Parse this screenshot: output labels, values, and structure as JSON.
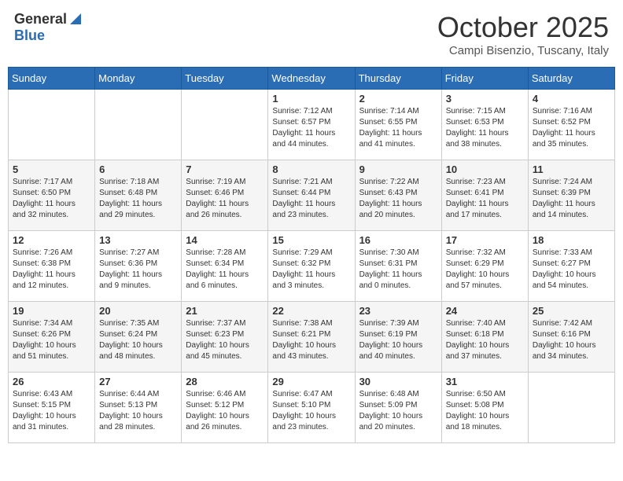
{
  "header": {
    "logo_general": "General",
    "logo_blue": "Blue",
    "month_title": "October 2025",
    "subtitle": "Campi Bisenzio, Tuscany, Italy"
  },
  "days_of_week": [
    "Sunday",
    "Monday",
    "Tuesday",
    "Wednesday",
    "Thursday",
    "Friday",
    "Saturday"
  ],
  "weeks": [
    [
      {
        "day": "",
        "info": ""
      },
      {
        "day": "",
        "info": ""
      },
      {
        "day": "",
        "info": ""
      },
      {
        "day": "1",
        "info": "Sunrise: 7:12 AM\nSunset: 6:57 PM\nDaylight: 11 hours and 44 minutes."
      },
      {
        "day": "2",
        "info": "Sunrise: 7:14 AM\nSunset: 6:55 PM\nDaylight: 11 hours and 41 minutes."
      },
      {
        "day": "3",
        "info": "Sunrise: 7:15 AM\nSunset: 6:53 PM\nDaylight: 11 hours and 38 minutes."
      },
      {
        "day": "4",
        "info": "Sunrise: 7:16 AM\nSunset: 6:52 PM\nDaylight: 11 hours and 35 minutes."
      }
    ],
    [
      {
        "day": "5",
        "info": "Sunrise: 7:17 AM\nSunset: 6:50 PM\nDaylight: 11 hours and 32 minutes."
      },
      {
        "day": "6",
        "info": "Sunrise: 7:18 AM\nSunset: 6:48 PM\nDaylight: 11 hours and 29 minutes."
      },
      {
        "day": "7",
        "info": "Sunrise: 7:19 AM\nSunset: 6:46 PM\nDaylight: 11 hours and 26 minutes."
      },
      {
        "day": "8",
        "info": "Sunrise: 7:21 AM\nSunset: 6:44 PM\nDaylight: 11 hours and 23 minutes."
      },
      {
        "day": "9",
        "info": "Sunrise: 7:22 AM\nSunset: 6:43 PM\nDaylight: 11 hours and 20 minutes."
      },
      {
        "day": "10",
        "info": "Sunrise: 7:23 AM\nSunset: 6:41 PM\nDaylight: 11 hours and 17 minutes."
      },
      {
        "day": "11",
        "info": "Sunrise: 7:24 AM\nSunset: 6:39 PM\nDaylight: 11 hours and 14 minutes."
      }
    ],
    [
      {
        "day": "12",
        "info": "Sunrise: 7:26 AM\nSunset: 6:38 PM\nDaylight: 11 hours and 12 minutes."
      },
      {
        "day": "13",
        "info": "Sunrise: 7:27 AM\nSunset: 6:36 PM\nDaylight: 11 hours and 9 minutes."
      },
      {
        "day": "14",
        "info": "Sunrise: 7:28 AM\nSunset: 6:34 PM\nDaylight: 11 hours and 6 minutes."
      },
      {
        "day": "15",
        "info": "Sunrise: 7:29 AM\nSunset: 6:32 PM\nDaylight: 11 hours and 3 minutes."
      },
      {
        "day": "16",
        "info": "Sunrise: 7:30 AM\nSunset: 6:31 PM\nDaylight: 11 hours and 0 minutes."
      },
      {
        "day": "17",
        "info": "Sunrise: 7:32 AM\nSunset: 6:29 PM\nDaylight: 10 hours and 57 minutes."
      },
      {
        "day": "18",
        "info": "Sunrise: 7:33 AM\nSunset: 6:27 PM\nDaylight: 10 hours and 54 minutes."
      }
    ],
    [
      {
        "day": "19",
        "info": "Sunrise: 7:34 AM\nSunset: 6:26 PM\nDaylight: 10 hours and 51 minutes."
      },
      {
        "day": "20",
        "info": "Sunrise: 7:35 AM\nSunset: 6:24 PM\nDaylight: 10 hours and 48 minutes."
      },
      {
        "day": "21",
        "info": "Sunrise: 7:37 AM\nSunset: 6:23 PM\nDaylight: 10 hours and 45 minutes."
      },
      {
        "day": "22",
        "info": "Sunrise: 7:38 AM\nSunset: 6:21 PM\nDaylight: 10 hours and 43 minutes."
      },
      {
        "day": "23",
        "info": "Sunrise: 7:39 AM\nSunset: 6:19 PM\nDaylight: 10 hours and 40 minutes."
      },
      {
        "day": "24",
        "info": "Sunrise: 7:40 AM\nSunset: 6:18 PM\nDaylight: 10 hours and 37 minutes."
      },
      {
        "day": "25",
        "info": "Sunrise: 7:42 AM\nSunset: 6:16 PM\nDaylight: 10 hours and 34 minutes."
      }
    ],
    [
      {
        "day": "26",
        "info": "Sunrise: 6:43 AM\nSunset: 5:15 PM\nDaylight: 10 hours and 31 minutes."
      },
      {
        "day": "27",
        "info": "Sunrise: 6:44 AM\nSunset: 5:13 PM\nDaylight: 10 hours and 28 minutes."
      },
      {
        "day": "28",
        "info": "Sunrise: 6:46 AM\nSunset: 5:12 PM\nDaylight: 10 hours and 26 minutes."
      },
      {
        "day": "29",
        "info": "Sunrise: 6:47 AM\nSunset: 5:10 PM\nDaylight: 10 hours and 23 minutes."
      },
      {
        "day": "30",
        "info": "Sunrise: 6:48 AM\nSunset: 5:09 PM\nDaylight: 10 hours and 20 minutes."
      },
      {
        "day": "31",
        "info": "Sunrise: 6:50 AM\nSunset: 5:08 PM\nDaylight: 10 hours and 18 minutes."
      },
      {
        "day": "",
        "info": ""
      }
    ]
  ]
}
